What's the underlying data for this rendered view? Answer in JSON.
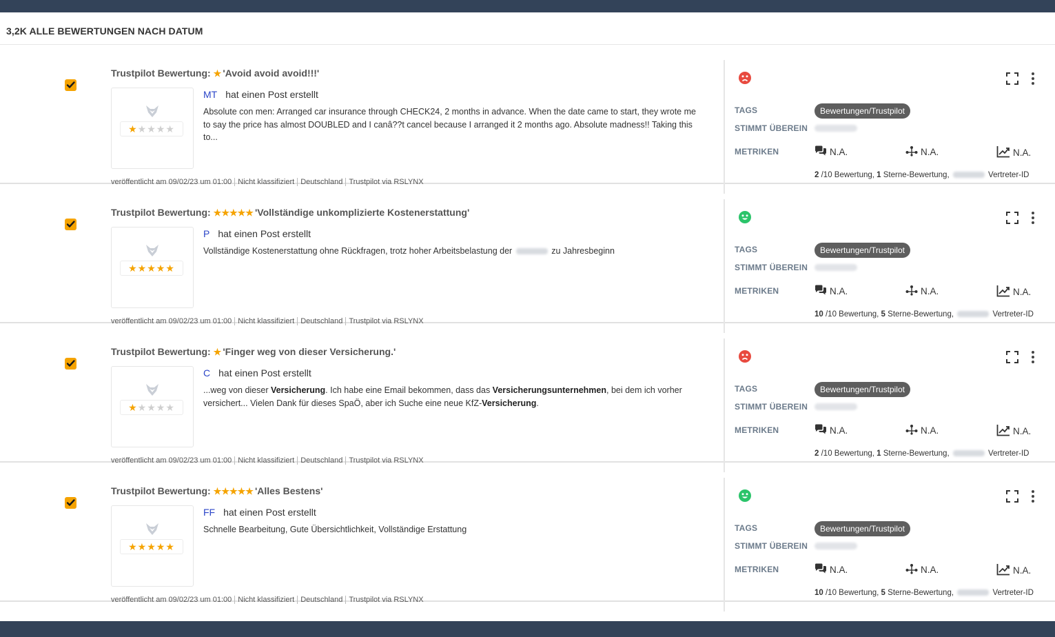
{
  "header": {
    "title": "3,2K ALLE BEWERTUNGEN NACH DATUM"
  },
  "labels": {
    "tags": "TAGS",
    "stimmt": "STIMMT ÜBEREIN",
    "metriken": "METRIKEN",
    "post_action": "hat einen Post erstellt"
  },
  "colors": {
    "accent": "#f5a300",
    "negative": "#e84a3f",
    "positive": "#2bc46a",
    "bar": "#334359"
  },
  "reviews": [
    {
      "title_prefix": "Trustpilot Bewertung:",
      "stars_title": "★",
      "quote": "'Avoid avoid avoid!!!'",
      "rating": 1,
      "thumb_on": "★",
      "thumb_off": "★★★★",
      "initials": "MT",
      "body": "Absolute con men: Arranged car insurance through CHECK24, 2 months in advance. When the date came to start, they wrote me to say the price has almost DOUBLED and I canâ??t cancel because I arranged it 2 months ago. Absolute madness!! Taking this to...",
      "meta": [
        "veröffentlicht am 09/02/23 um 01:00",
        "Nicht klassifiziert",
        "Deutschland",
        "Trustpilot via RSLYNX"
      ],
      "sentiment": "negative",
      "tag": "Bewertungen/Trustpilot",
      "metrics": [
        "N.A.",
        "N.A.",
        "N.A."
      ],
      "summary_score": "2",
      "summary_text": " /10 Bewertung, ",
      "summary_stars": "1",
      "summary_text2": " Sterne-Bewertung, ",
      "summary_id": "Vertreter-ID"
    },
    {
      "title_prefix": "Trustpilot Bewertung:",
      "stars_title": "★★★★★",
      "quote": "'Vollständige unkomplizierte Kostenerstattung'",
      "rating": 5,
      "thumb_on": "★★★★★",
      "thumb_off": "",
      "initials": "P",
      "body": "Vollständige Kostenerstattung ohne Rückfragen, trotz hoher Arbeitsbelastung der",
      "body_tail": "zu Jahresbeginn",
      "meta": [
        "veröffentlicht am 09/02/23 um 01:00",
        "Nicht klassifiziert",
        "Deutschland",
        "Trustpilot via RSLYNX"
      ],
      "sentiment": "positive",
      "tag": "Bewertungen/Trustpilot",
      "metrics": [
        "N.A.",
        "N.A.",
        "N.A."
      ],
      "summary_score": "10",
      "summary_text": " /10 Bewertung, ",
      "summary_stars": "5",
      "summary_text2": " Sterne-Bewertung, ",
      "summary_id": "Vertreter-ID"
    },
    {
      "title_prefix": "Trustpilot Bewertung:",
      "stars_title": "★",
      "quote": "'Finger weg von dieser Versicherung.'",
      "rating": 1,
      "thumb_on": "★",
      "thumb_off": "★★★★",
      "initials": "C",
      "body_parts": [
        "...weg von dieser ",
        "Versicherung",
        ". Ich habe eine Email bekommen, dass das ",
        "Versicherungsunternehmen",
        ", bei dem ich vorher versichert... Vielen Dank für dieses SpaÖ, aber ich Suche eine neue KfZ-",
        "Versicherung",
        "."
      ],
      "meta": [
        "veröffentlicht am 09/02/23 um 01:00",
        "Nicht klassifiziert",
        "Deutschland",
        "Trustpilot via RSLYNX"
      ],
      "sentiment": "negative",
      "tag": "Bewertungen/Trustpilot",
      "metrics": [
        "N.A.",
        "N.A.",
        "N.A."
      ],
      "summary_score": "2",
      "summary_text": " /10 Bewertung, ",
      "summary_stars": "1",
      "summary_text2": " Sterne-Bewertung, ",
      "summary_id": "Vertreter-ID"
    },
    {
      "title_prefix": "Trustpilot Bewertung:",
      "stars_title": "★★★★★",
      "quote": "'Alles Bestens'",
      "rating": 5,
      "thumb_on": "★★★★★",
      "thumb_off": "",
      "initials": "FF",
      "body": "Schnelle Bearbeitung, Gute Übersichtlichkeit, Vollständige Erstattung",
      "meta": [
        "veröffentlicht am 09/02/23 um 01:00",
        "Nicht klassifiziert",
        "Deutschland",
        "Trustpilot via RSLYNX"
      ],
      "sentiment": "positive",
      "tag": "Bewertungen/Trustpilot",
      "metrics": [
        "N.A.",
        "N.A.",
        "N.A."
      ],
      "summary_score": "10",
      "summary_text": " /10 Bewertung, ",
      "summary_stars": "5",
      "summary_text2": " Sterne-Bewertung, ",
      "summary_id": "Vertreter-ID"
    }
  ]
}
